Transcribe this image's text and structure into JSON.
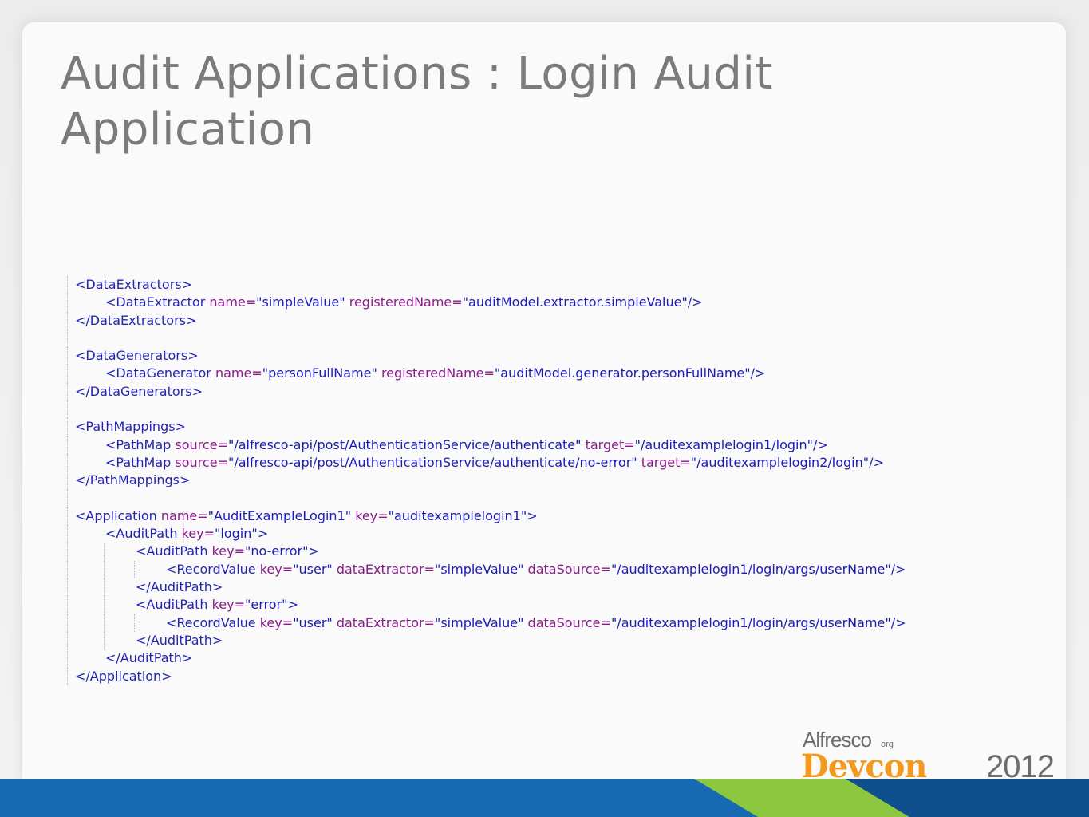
{
  "slide": {
    "title_line1": "Audit Applications : Login Audit",
    "title_line2": "Application"
  },
  "code_lines": [
    {
      "indent": 0,
      "parts": [
        [
          "t",
          "<DataExtractors>"
        ]
      ]
    },
    {
      "indent": 1,
      "parts": [
        [
          "t",
          "<DataExtractor "
        ],
        [
          "a",
          "name="
        ],
        [
          "v",
          "\"simpleValue\" "
        ],
        [
          "a",
          "registeredName="
        ],
        [
          "v",
          "\"auditModel.extractor.simpleValue\""
        ],
        [
          "t",
          "/>"
        ]
      ]
    },
    {
      "indent": 0,
      "parts": [
        [
          "t",
          "</DataExtractors>"
        ]
      ]
    },
    {
      "blank": true
    },
    {
      "indent": 0,
      "parts": [
        [
          "t",
          "<DataGenerators>"
        ]
      ]
    },
    {
      "indent": 1,
      "parts": [
        [
          "t",
          "<DataGenerator "
        ],
        [
          "a",
          "name="
        ],
        [
          "v",
          "\"personFullName\" "
        ],
        [
          "a",
          "registeredName="
        ],
        [
          "v",
          "\"auditModel.generator.personFullName\""
        ],
        [
          "t",
          "/>"
        ]
      ]
    },
    {
      "indent": 0,
      "parts": [
        [
          "t",
          "</DataGenerators>"
        ]
      ]
    },
    {
      "blank": true
    },
    {
      "indent": 0,
      "parts": [
        [
          "t",
          "<PathMappings>"
        ]
      ]
    },
    {
      "indent": 1,
      "parts": [
        [
          "t",
          "<PathMap "
        ],
        [
          "a",
          "source="
        ],
        [
          "v",
          "\"/alfresco-api/post/AuthenticationService/authenticate\" "
        ],
        [
          "a",
          "target="
        ],
        [
          "v",
          "\"/auditexamplelogin1/login\""
        ],
        [
          "t",
          "/>"
        ]
      ]
    },
    {
      "indent": 1,
      "parts": [
        [
          "t",
          "<PathMap "
        ],
        [
          "a",
          "source="
        ],
        [
          "v",
          "\"/alfresco-api/post/AuthenticationService/authenticate/no-error\" "
        ],
        [
          "a",
          "target="
        ],
        [
          "v",
          "\"/auditexamplelogin2/login\""
        ],
        [
          "t",
          "/>"
        ]
      ]
    },
    {
      "indent": 0,
      "parts": [
        [
          "t",
          "</PathMappings>"
        ]
      ]
    },
    {
      "blank": true
    },
    {
      "indent": 0,
      "parts": [
        [
          "t",
          "<Application "
        ],
        [
          "a",
          "name="
        ],
        [
          "v",
          "\"AuditExampleLogin1\" "
        ],
        [
          "a",
          "key="
        ],
        [
          "v",
          "\"auditexamplelogin1\""
        ],
        [
          "t",
          ">"
        ]
      ]
    },
    {
      "indent": 1,
      "parts": [
        [
          "t",
          "<AuditPath "
        ],
        [
          "a",
          "key="
        ],
        [
          "v",
          "\"login\""
        ],
        [
          "t",
          ">"
        ]
      ]
    },
    {
      "indent": 2,
      "parts": [
        [
          "t",
          "<AuditPath "
        ],
        [
          "a",
          "key="
        ],
        [
          "v",
          "\"no-error\""
        ],
        [
          "t",
          ">"
        ]
      ]
    },
    {
      "indent": 3,
      "parts": [
        [
          "t",
          "<RecordValue "
        ],
        [
          "a",
          "key="
        ],
        [
          "v",
          "\"user\" "
        ],
        [
          "a",
          "dataExtractor="
        ],
        [
          "v",
          "\"simpleValue\" "
        ],
        [
          "a",
          "dataSource="
        ],
        [
          "v",
          "\"/auditexamplelogin1/login/args/userName\""
        ],
        [
          "t",
          "/>"
        ]
      ]
    },
    {
      "indent": 2,
      "parts": [
        [
          "t",
          "</AuditPath>"
        ]
      ]
    },
    {
      "indent": 2,
      "parts": [
        [
          "t",
          "<AuditPath "
        ],
        [
          "a",
          "key="
        ],
        [
          "v",
          "\"error\""
        ],
        [
          "t",
          ">"
        ]
      ]
    },
    {
      "indent": 3,
      "parts": [
        [
          "t",
          "<RecordValue "
        ],
        [
          "a",
          "key="
        ],
        [
          "v",
          "\"user\" "
        ],
        [
          "a",
          "dataExtractor="
        ],
        [
          "v",
          "\"simpleValue\" "
        ],
        [
          "a",
          "dataSource="
        ],
        [
          "v",
          "\"/auditexamplelogin1/login/args/userName\""
        ],
        [
          "t",
          "/>"
        ]
      ]
    },
    {
      "indent": 2,
      "parts": [
        [
          "t",
          "</AuditPath>"
        ]
      ]
    },
    {
      "indent": 1,
      "parts": [
        [
          "t",
          "</AuditPath>"
        ]
      ]
    },
    {
      "indent": 0,
      "parts": [
        [
          "t",
          "</Application>"
        ]
      ]
    }
  ],
  "logo": {
    "brand": "Alfresco",
    "brand_suffix": "org",
    "event": "Devcon",
    "year": "2012"
  },
  "colors": {
    "footer_blue": "#1769b2",
    "footer_green": "#8dc63f",
    "footer_navy": "#0f4f8c",
    "devcon_orange": "#f39a1e",
    "tag_blue": "#2323b5",
    "attr_purple": "#8b1a8b",
    "title_gray": "#7b7b7b"
  }
}
